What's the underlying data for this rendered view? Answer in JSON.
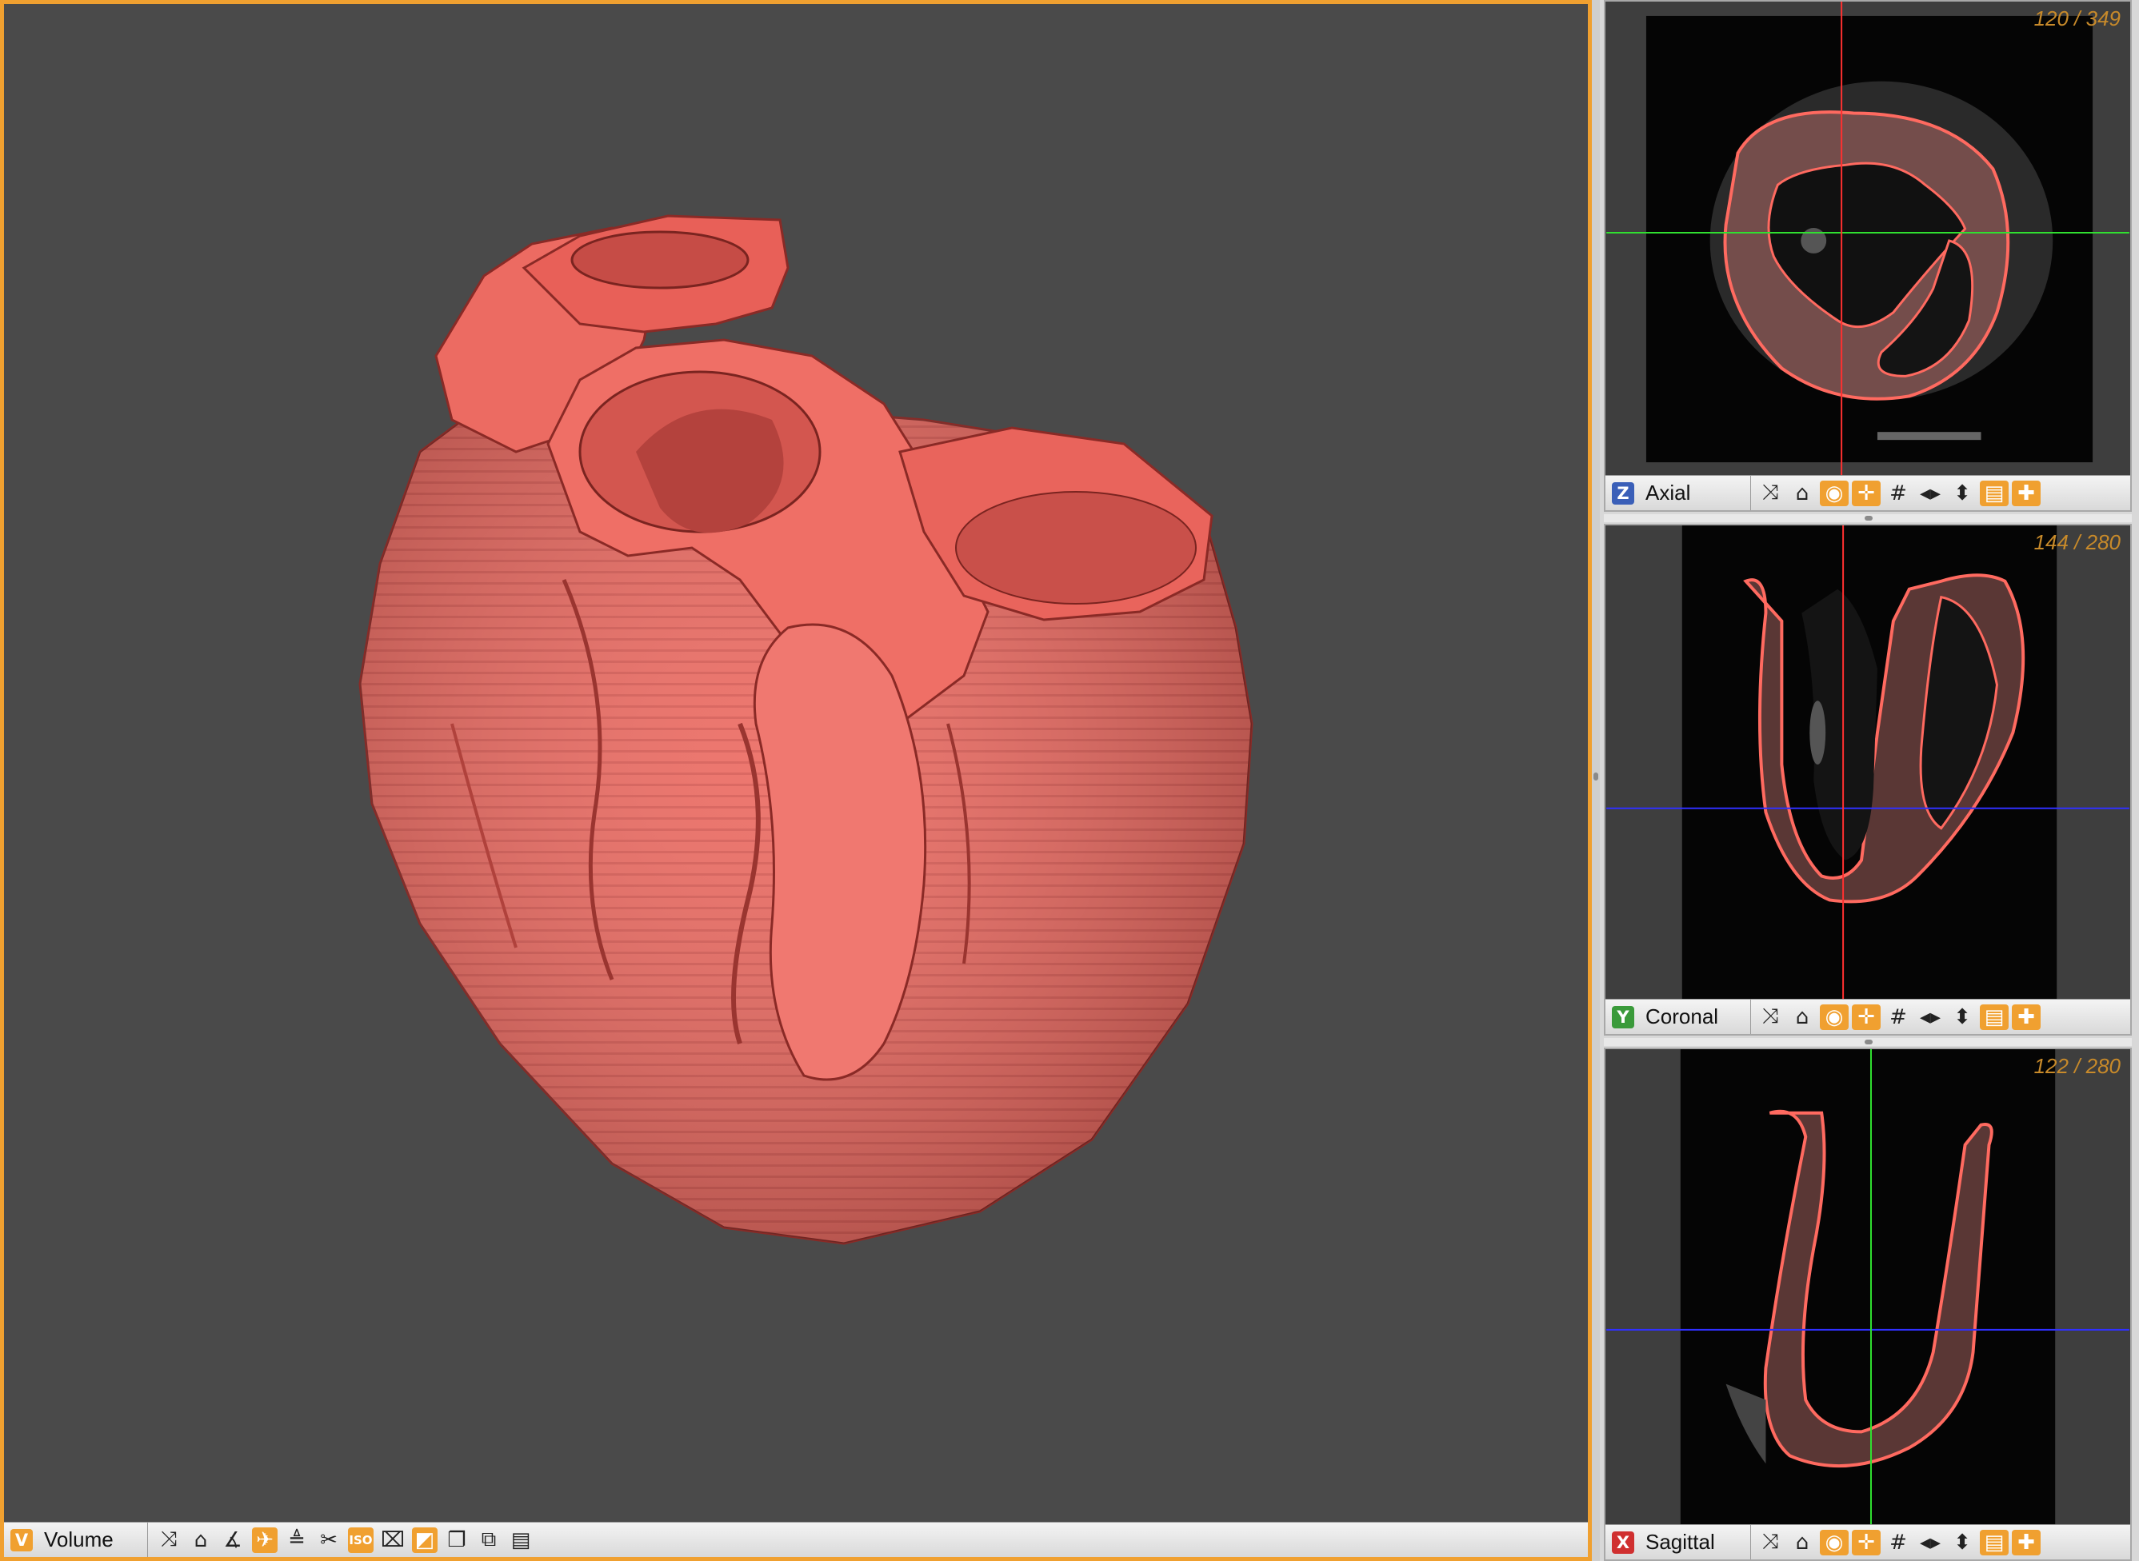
{
  "main_view": {
    "label": "Volume",
    "badge": "V",
    "badge_color": "#f0a030",
    "tools": [
      {
        "icon": "collapse-icon",
        "glyph": "⤨",
        "active": false
      },
      {
        "icon": "lock-icon",
        "glyph": "⌂",
        "active": false
      },
      {
        "icon": "angle-icon",
        "glyph": "∡",
        "active": false
      },
      {
        "icon": "rotate-icon",
        "glyph": "✈",
        "active": true
      },
      {
        "icon": "cone-icon",
        "glyph": "≜",
        "active": false
      },
      {
        "icon": "scissors-icon",
        "glyph": "✂",
        "active": false
      },
      {
        "icon": "iso-icon",
        "glyph": "ISO",
        "active": true
      },
      {
        "icon": "crop-icon",
        "glyph": "⌧",
        "active": false
      },
      {
        "icon": "contrast-icon",
        "glyph": "◩",
        "active": true
      },
      {
        "icon": "copy-icon",
        "glyph": "❐",
        "active": false
      },
      {
        "icon": "cube-icon",
        "glyph": "⧉",
        "active": false
      },
      {
        "icon": "panel-icon",
        "glyph": "▤",
        "active": false
      }
    ]
  },
  "slice_views": [
    {
      "label": "Axial",
      "badge": "Z",
      "badge_color": "#3a5fb8",
      "counter": "120 / 349"
    },
    {
      "label": "Coronal",
      "badge": "Y",
      "badge_color": "#3a9a3a",
      "counter": "144 / 280"
    },
    {
      "label": "Sagittal",
      "badge": "X",
      "badge_color": "#d03030",
      "counter": "122 / 280"
    }
  ],
  "slice_tools": [
    {
      "icon": "collapse-icon",
      "glyph": "⤨",
      "active": false
    },
    {
      "icon": "lock-icon",
      "glyph": "⌂",
      "active": false
    },
    {
      "icon": "eye-icon",
      "glyph": "◉",
      "active": true
    },
    {
      "icon": "crosshair-icon",
      "glyph": "✛",
      "active": true
    },
    {
      "icon": "grid-icon",
      "glyph": "#",
      "active": false
    },
    {
      "icon": "flip-horizontal-icon",
      "glyph": "◂▸",
      "active": false
    },
    {
      "icon": "flip-vertical-icon",
      "glyph": "⬍",
      "active": false
    },
    {
      "icon": "notes-icon",
      "glyph": "▤",
      "active": true
    },
    {
      "icon": "add-icon",
      "glyph": "✚",
      "active": true
    }
  ],
  "colors": {
    "accent": "#f0a030",
    "segmentation": "#ec6b62",
    "crosshair_red": "#ff3030",
    "crosshair_green": "#30e030",
    "crosshair_blue": "#3030ff"
  }
}
